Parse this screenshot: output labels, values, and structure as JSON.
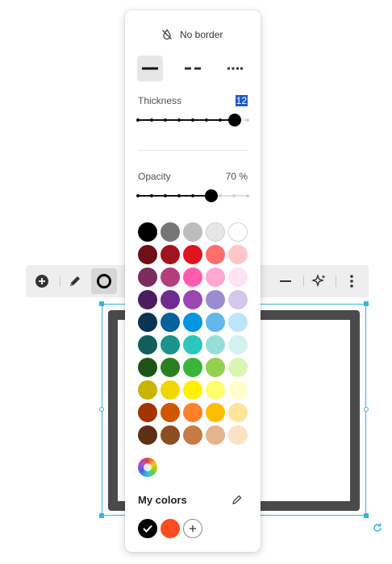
{
  "popup": {
    "no_border_label": "No border",
    "line_styles": [
      {
        "name": "solid",
        "selected": true
      },
      {
        "name": "dashed",
        "selected": false
      },
      {
        "name": "dotted",
        "selected": false
      }
    ],
    "thickness": {
      "label": "Thickness",
      "value": "12",
      "fraction": 0.88
    },
    "opacity": {
      "label": "Opacity",
      "value": "70 %",
      "fraction": 0.67
    },
    "palette": [
      [
        "#000000",
        "#757575",
        "#bdbdbd",
        "#e6e6e6",
        "#ffffff"
      ],
      [
        "#6f0f17",
        "#a3121f",
        "#e0131f",
        "#ff6d6d",
        "#ffc6c9"
      ],
      [
        "#7a2c5a",
        "#b33d7d",
        "#ff5cad",
        "#ffa6d2",
        "#ffe3f1"
      ],
      [
        "#4b1c5e",
        "#6f2b8e",
        "#9b46b5",
        "#9a8cd1",
        "#d3c7ea"
      ],
      [
        "#0a3452",
        "#04619d",
        "#0096e0",
        "#62b8ea",
        "#bde6fb"
      ],
      [
        "#125e5b",
        "#1a938b",
        "#2bc7bd",
        "#94e0d9",
        "#d3f2f0"
      ],
      [
        "#1f5418",
        "#2b7f21",
        "#3bb538",
        "#92d050",
        "#d9f5b2"
      ],
      [
        "#c8b400",
        "#f2d600",
        "#fff100",
        "#ffff6d",
        "#ffffcc"
      ],
      [
        "#a33402",
        "#cf5700",
        "#ff7f2a",
        "#ffbf00",
        "#ffe599"
      ],
      [
        "#5a3114",
        "#8b4e22",
        "#c87a45",
        "#e6b48f",
        "#fbe2c2"
      ]
    ],
    "my_colors_label": "My colors",
    "my_colors": [
      {
        "color": "#000000",
        "selected": true
      },
      {
        "color": "#ff4c1f",
        "selected": false
      }
    ]
  },
  "toolbar": {
    "items": [
      "add-icon",
      "pen-icon",
      "border-icon",
      "line-icon",
      "sparkle-icon",
      "more-icon"
    ]
  },
  "shape": {
    "border_color": "#4a4a4a",
    "selection_color": "#36b4e6"
  }
}
